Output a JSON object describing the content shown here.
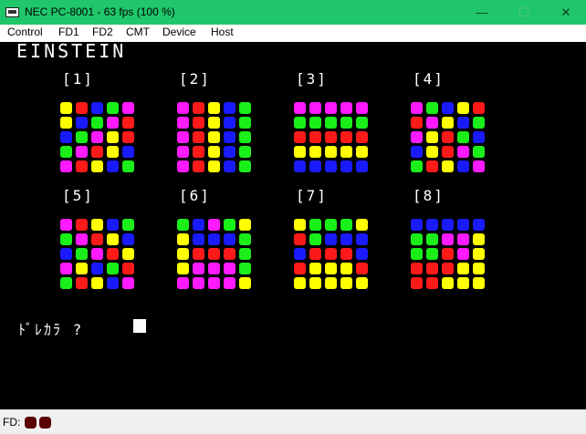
{
  "window": {
    "title": "NEC PC-8001 - 63 fps (100 %)",
    "min_glyph": "—",
    "max_glyph": "☐",
    "close_glyph": "✕"
  },
  "menu": [
    "Control",
    "FD1",
    "FD2",
    "CMT",
    "Device",
    "Host"
  ],
  "screen": {
    "heading": "EINSTEIN",
    "prompt": "ﾄﾞﾚｶﾗ ?",
    "colors": {
      "R": "#ff1a1a",
      "G": "#1aef1a",
      "B": "#1a1aff",
      "Y": "#ffff00",
      "M": "#ff1aff"
    },
    "panels": [
      {
        "label": "[1]",
        "rows": [
          "YRBGM",
          "YBGMR",
          "BGMYR",
          "GMRYB",
          "MRYBG"
        ]
      },
      {
        "label": "[2]",
        "rows": [
          "MRYBG",
          "MRYBG",
          "MRYBG",
          "MRYBG",
          "MRYBG"
        ]
      },
      {
        "label": "[3]",
        "rows": [
          "MMMMM",
          "GGGGG",
          "RRRRR",
          "YYYYY",
          "BBBBB"
        ]
      },
      {
        "label": "[4]",
        "rows": [
          "MGBYR",
          "RMYBG",
          "MYRGB",
          "BYRMG",
          "GRYBM"
        ]
      },
      {
        "label": "[5]",
        "rows": [
          "MRYBG",
          "GMRYB",
          "BGMRY",
          "MYBGR",
          "GRYBM"
        ]
      },
      {
        "label": "[6]",
        "rows": [
          "GBMGY",
          "YBBBG",
          "YRRRG",
          "YMMMG",
          "MMMMY"
        ]
      },
      {
        "label": "[7]",
        "rows": [
          "YGGGY",
          "RGBBB",
          "BRRRB",
          "RYYYR",
          "YYYYY"
        ]
      },
      {
        "label": "[8]",
        "rows": [
          "BBBBB",
          "GGMMY",
          "GGRMY",
          "RRRYY",
          "RRYYY"
        ]
      }
    ]
  },
  "status": {
    "label": "FD:",
    "drives": [
      "drive-1",
      "drive-2"
    ]
  }
}
